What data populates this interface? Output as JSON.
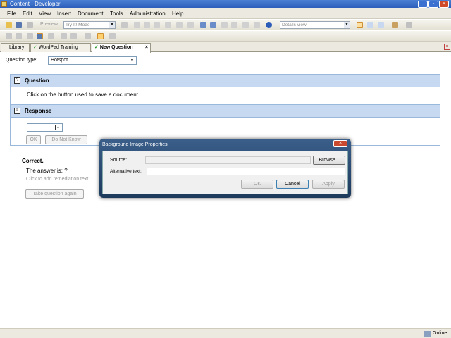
{
  "window": {
    "title": "Content - Developer"
  },
  "menu": [
    "File",
    "Edit",
    "View",
    "Insert",
    "Document",
    "Tools",
    "Administration",
    "Help"
  ],
  "toolbar": {
    "preview_label": "Preview",
    "mode_value": "Try It! Mode",
    "view_value": "Details view"
  },
  "tabs": [
    {
      "label": "Library"
    },
    {
      "label": "WordPad Training"
    },
    {
      "label": "New Question"
    }
  ],
  "question_type": {
    "label": "Question type:",
    "value": "Hotspot"
  },
  "question": {
    "header": "Question",
    "text": "Click on the button used to save a document."
  },
  "response": {
    "header": "Response",
    "ok_label": "OK",
    "dont_know_label": "Do Not Know"
  },
  "feedback": {
    "heading": "Correct.",
    "answer_text": "The answer is: ?",
    "remediation_text": "Click to add remediation text",
    "retake_label": "Take question again"
  },
  "dialog": {
    "title": "Background Image Properties",
    "source_label": "Source:",
    "browse_label": "Browse...",
    "alt_label": "Alternative text:",
    "alt_value": "",
    "ok_label": "OK",
    "cancel_label": "Cancel",
    "apply_label": "Apply"
  },
  "status": {
    "text": "Online"
  }
}
